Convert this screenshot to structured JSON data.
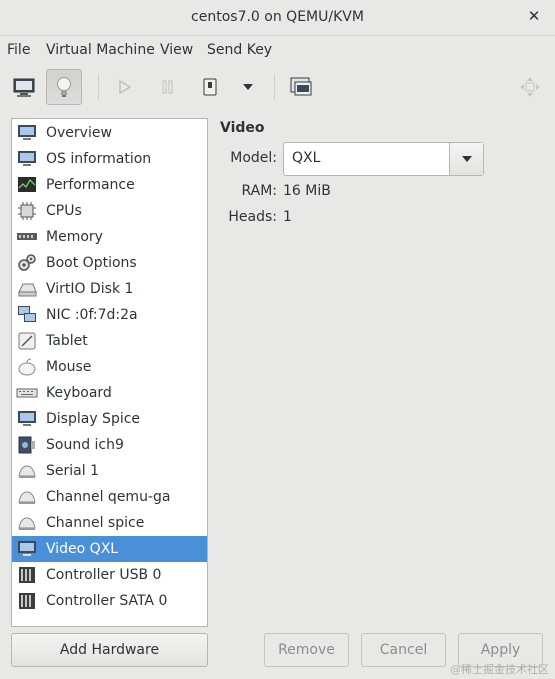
{
  "window": {
    "title": "centos7.0 on QEMU/KVM"
  },
  "menu": [
    "File",
    "Virtual Machine",
    "View",
    "Send Key"
  ],
  "toolbar": {
    "icons": [
      "monitor-icon",
      "lightbulb-icon",
      "play-icon",
      "pause-icon",
      "power-icon",
      "chevron-down-icon",
      "console-icon",
      "fullscreen-icon"
    ]
  },
  "sidebar": {
    "items": [
      {
        "label": "Overview",
        "icon": "monitor-icon"
      },
      {
        "label": "OS information",
        "icon": "monitor-icon"
      },
      {
        "label": "Performance",
        "icon": "graph-icon"
      },
      {
        "label": "CPUs",
        "icon": "chip-icon"
      },
      {
        "label": "Memory",
        "icon": "memory-icon"
      },
      {
        "label": "Boot Options",
        "icon": "gears-icon"
      },
      {
        "label": "VirtIO Disk 1",
        "icon": "disk-icon"
      },
      {
        "label": "NIC :0f:7d:2a",
        "icon": "network-icon"
      },
      {
        "label": "Tablet",
        "icon": "tablet-icon"
      },
      {
        "label": "Mouse",
        "icon": "mouse-icon"
      },
      {
        "label": "Keyboard",
        "icon": "keyboard-icon"
      },
      {
        "label": "Display Spice",
        "icon": "monitor-icon"
      },
      {
        "label": "Sound ich9",
        "icon": "sound-card-icon"
      },
      {
        "label": "Serial 1",
        "icon": "serial-icon"
      },
      {
        "label": "Channel qemu-ga",
        "icon": "channel-icon"
      },
      {
        "label": "Channel spice",
        "icon": "channel-icon"
      },
      {
        "label": "Video QXL",
        "icon": "monitor-icon",
        "selected": true
      },
      {
        "label": "Controller USB 0",
        "icon": "controller-icon"
      },
      {
        "label": "Controller SATA 0",
        "icon": "controller-icon"
      }
    ],
    "add_label": "Add Hardware"
  },
  "details": {
    "section": "Video",
    "model_label": "Model:",
    "model_value": "QXL",
    "ram_label": "RAM:",
    "ram_value": "16 MiB",
    "heads_label": "Heads:",
    "heads_value": "1"
  },
  "buttons": {
    "remove": "Remove",
    "cancel": "Cancel",
    "apply": "Apply"
  },
  "watermark": "@稀土掘金技术社区",
  "colors": {
    "selection": "#4a90d9",
    "window_bg": "#e8e8e7"
  }
}
